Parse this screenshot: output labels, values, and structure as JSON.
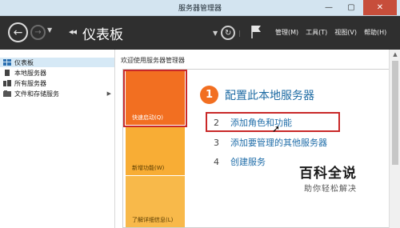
{
  "window": {
    "title": "服务器管理器",
    "min_glyph": "—",
    "max_glyph": "▢",
    "close_glyph": "✕"
  },
  "header": {
    "back_glyph": "←",
    "forward_glyph": "→",
    "breadcrumb_glyph": "◂◂",
    "title": "仪表板",
    "menus": [
      {
        "label": "管理(M)"
      },
      {
        "label": "工具(T)"
      },
      {
        "label": "视图(V)"
      },
      {
        "label": "帮助(H)"
      }
    ]
  },
  "sidebar": {
    "items": [
      {
        "label": "仪表板",
        "icon": "dashboard-icon",
        "selected": true
      },
      {
        "label": "本地服务器",
        "icon": "server-icon"
      },
      {
        "label": "所有服务器",
        "icon": "servers-icon"
      },
      {
        "label": "文件和存储服务",
        "icon": "storage-icon",
        "has_children": true
      }
    ]
  },
  "main": {
    "welcome_title": "欢迎使用服务器管理器",
    "tiles": {
      "quick_start": "快速启动(Q)",
      "whats_new": "新增功能(W)",
      "learn_more": "了解详细信息(L)"
    },
    "step1": {
      "number": "1",
      "text": "配置此本地服务器"
    },
    "steps": [
      {
        "number": "2",
        "text": "添加角色和功能"
      },
      {
        "number": "3",
        "text": "添加要管理的其他服务器"
      },
      {
        "number": "4",
        "text": "创建服务"
      }
    ]
  },
  "watermark": {
    "title": "百科全说",
    "subtitle": "助你轻松解决"
  },
  "colors": {
    "accent_orange": "#f26f21",
    "highlight_red": "#c92828",
    "link_blue": "#1e6ca8",
    "header_dark": "#2f2f2f"
  }
}
